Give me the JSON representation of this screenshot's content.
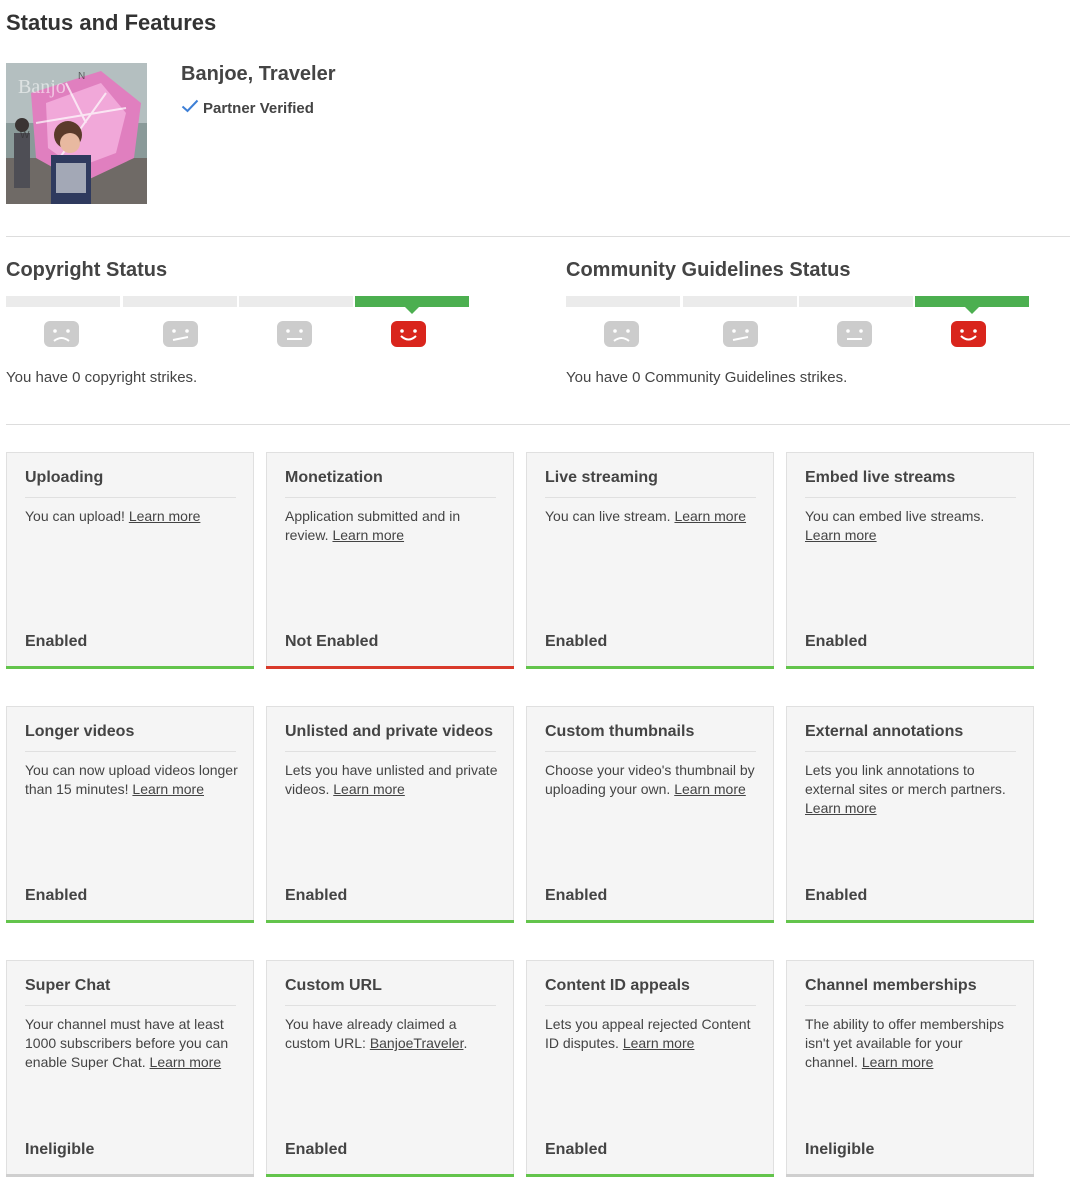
{
  "page": {
    "title": "Status and Features"
  },
  "channel": {
    "name": "Banjoe, Traveler",
    "badge": "Partner Verified"
  },
  "colors": {
    "enabled": "#63c44c",
    "not_enabled": "#d93a2b",
    "ineligible": "#cfcfcf",
    "strike_active": "#4caf50",
    "happy_face": "#d9251c",
    "sad_face": "#cccccc"
  },
  "copyright": {
    "heading": "Copyright Status",
    "strikes_text": "You have 0 copyright strikes.",
    "active_level": 4
  },
  "community": {
    "heading": "Community Guidelines Status",
    "strikes_text": "You have 0 Community Guidelines strikes.",
    "active_level": 4
  },
  "features": [
    {
      "title": "Uploading",
      "text": "You can upload!",
      "link": "Learn more",
      "after": "",
      "status": "Enabled",
      "state": "enabled"
    },
    {
      "title": "Monetization",
      "text": "Application submitted and in review.",
      "link": "Learn more",
      "after": "",
      "status": "Not Enabled",
      "state": "not_enabled"
    },
    {
      "title": "Live streaming",
      "text": "You can live stream.",
      "link": "Learn more",
      "after": "",
      "status": "Enabled",
      "state": "enabled"
    },
    {
      "title": "Embed live streams",
      "text": "You can embed live streams.",
      "link": "Learn more",
      "after": "",
      "status": "Enabled",
      "state": "enabled"
    },
    {
      "title": "Longer videos",
      "text": "You can now upload videos longer than 15 minutes!",
      "link": "Learn more",
      "after": "",
      "status": "Enabled",
      "state": "enabled"
    },
    {
      "title": "Unlisted and private videos",
      "text": "Lets you have unlisted and private videos.",
      "link": "Learn more",
      "after": "",
      "status": "Enabled",
      "state": "enabled"
    },
    {
      "title": "Custom thumbnails",
      "text": "Choose your video's thumbnail by uploading your own.",
      "link": "Learn more",
      "after": "",
      "status": "Enabled",
      "state": "enabled"
    },
    {
      "title": "External annotations",
      "text": "Lets you link annotations to external sites or merch partners.",
      "link": "Learn more",
      "after": "",
      "status": "Enabled",
      "state": "enabled"
    },
    {
      "title": "Super Chat",
      "text": "Your channel must have at least 1000 subscribers before you can enable Super Chat.",
      "link": "Learn more",
      "after": "",
      "status": "Ineligible",
      "state": "ineligible"
    },
    {
      "title": "Custom URL",
      "text": "You have already claimed a custom URL:",
      "link": "BanjoeTraveler",
      "after": ".",
      "status": "Enabled",
      "state": "enabled"
    },
    {
      "title": "Content ID appeals",
      "text": "Lets you appeal rejected Content ID disputes.",
      "link": "Learn more",
      "after": "",
      "status": "Enabled",
      "state": "enabled"
    },
    {
      "title": "Channel memberships",
      "text": "The ability to offer memberships isn't yet available for your channel.",
      "link": "Learn more",
      "after": "",
      "status": "Ineligible",
      "state": "ineligible"
    }
  ]
}
